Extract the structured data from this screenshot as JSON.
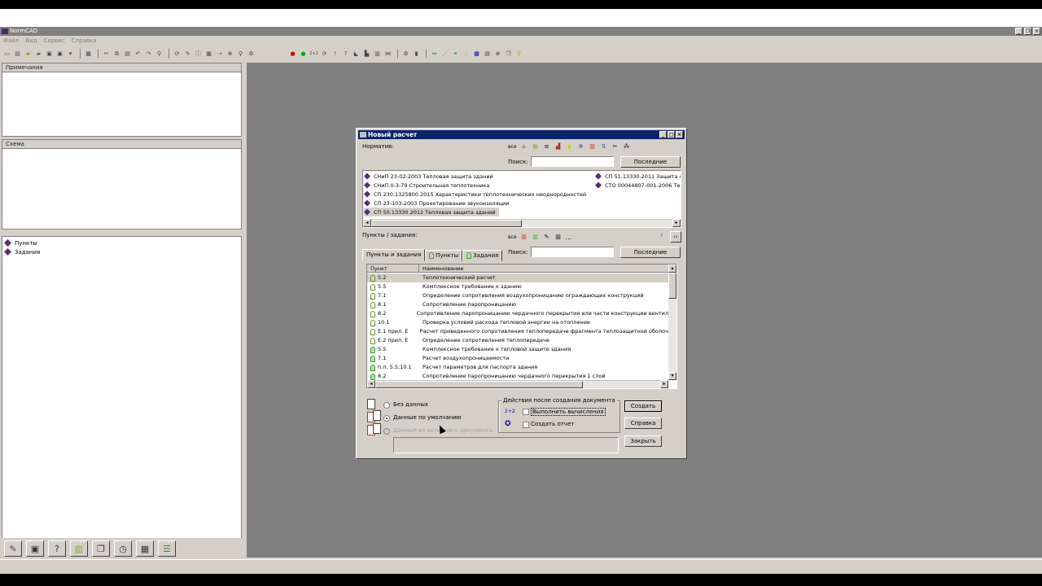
{
  "app": {
    "title": "NormCAD",
    "menu": [
      "Файл",
      "Вид",
      "Сервис",
      "Справка"
    ]
  },
  "left": {
    "notes_title": "Примечания",
    "scheme_title": "Схема",
    "tree": [
      {
        "label": "Пункты",
        "icon": "book-icon"
      },
      {
        "label": "Задания",
        "icon": "book-icon"
      }
    ]
  },
  "dialog": {
    "title": "Новый расчет",
    "norm_label": "Норматив:",
    "all_label": "все",
    "search_label": "Поиск:",
    "recent_button": "Последние",
    "norms_col1": [
      "СНиП 23-02-2003 Тепловая защита зданий",
      "СНиП II-3-79 Строительная теплотехника",
      "СП 230.1325800.2015 Характеристики теплотехнических неоднородностей",
      "СП 23-103-2003 Проектирование звукоизоляции",
      "СП 50.13330.2012 Тепловая защита зданий"
    ],
    "norms_col2": [
      "СП 51.13330.2011 Защита о",
      "СТО 00044807-001-2006 Те"
    ],
    "points_label": "Пункты / задания:",
    "all_label2": "все",
    "dots": "...",
    "search_label2": "Поиск:",
    "recent_button2": "Последние",
    "tabs": [
      "Пункты и задания",
      "Пункты",
      "Задания"
    ],
    "grid_headers": [
      "Пункт",
      "Наименование"
    ],
    "rows": [
      {
        "p": "5.2",
        "n": "Теплотехнический расчет",
        "g": false
      },
      {
        "p": "5.5",
        "n": "Комплексное требование к зданию",
        "g": false
      },
      {
        "p": "7.1",
        "n": "Определение сопротивления воздухопроницанию ограждающих конструкций",
        "g": false
      },
      {
        "p": "8.1",
        "n": "Сопротивление паропроницанию",
        "g": false
      },
      {
        "p": "8.2",
        "n": "Сопротивление паропроницанию чердачного перекрытия или части конструкции вентил",
        "g": false
      },
      {
        "p": "10.1",
        "n": "Проверка условий расхода тепловой энергии на отопление",
        "g": false
      },
      {
        "p": "Е.1 прил. Е",
        "n": "Расчет приведенного сопротивления теплопередаче фрагмента теплозащитной оболоч",
        "g": false
      },
      {
        "p": "Е.2 прил. Е",
        "n": "Определение сопротивления теплопередаче",
        "g": false
      },
      {
        "p": "5.5",
        "n": "Комплексное требование к тепловой защите здания",
        "g": true
      },
      {
        "p": "7.1",
        "n": "Расчет воздухопроницаемости",
        "g": true
      },
      {
        "p": "п.п. 5.5;10.1",
        "n": "Расчет параметров для паспорта здания",
        "g": true
      },
      {
        "p": "8.2",
        "n": "Сопротивление паропроницанию чердачного перекрытия 1 слой",
        "g": true
      }
    ],
    "radio_no_data": "Без данных",
    "radio_default": "Данные по умолчанию",
    "radio_active": "Данные из активного документа",
    "actions_title": "Действия после создания документа",
    "calc_icon": "2+2",
    "chk_calc": "Выполнить вычисления",
    "chk_report": "Создать отчет",
    "btn_create": "Создать",
    "btn_help": "Справка",
    "btn_close": "Закрыть"
  }
}
